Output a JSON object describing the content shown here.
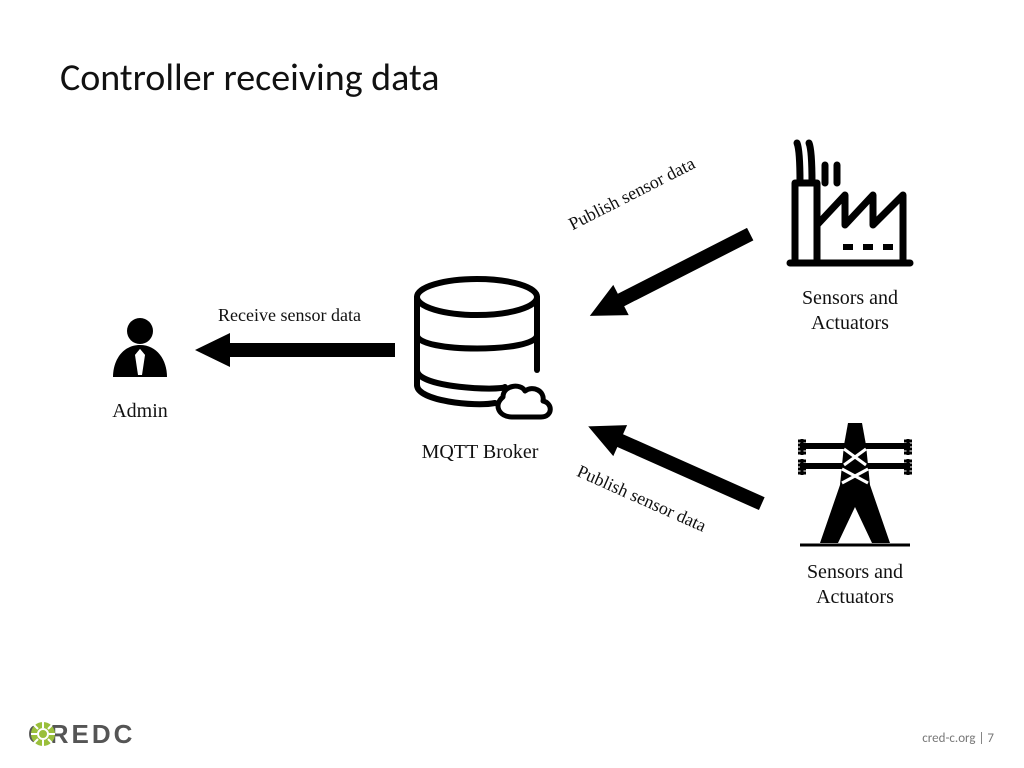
{
  "title": "Controller receiving data",
  "nodes": {
    "admin": "Admin",
    "broker": "MQTT Broker",
    "factory": "Sensors and\nActuators",
    "tower": "Sensors and\nActuators"
  },
  "edges": {
    "receive": "Receive sensor data",
    "publish_top": "Publish sensor data",
    "publish_bottom": "Publish sensor data"
  },
  "footer": {
    "site": "cred-c.org",
    "sep": " | ",
    "page": "7",
    "logo_text": "CREDC"
  }
}
